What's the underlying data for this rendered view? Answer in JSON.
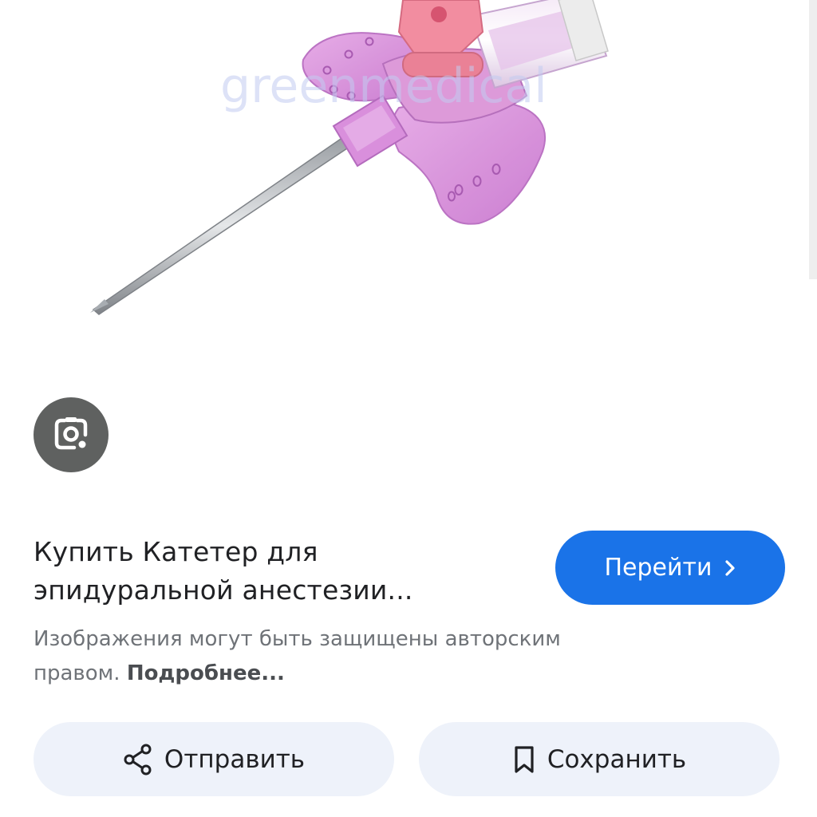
{
  "image": {
    "watermark": "greenmedical",
    "icon": "catheter-product-image"
  },
  "lens": {
    "icon": "lens-icon"
  },
  "result": {
    "title": "Купить Катетер для эпидуральной анестезии...",
    "goto_label": "Перейти",
    "goto_icon": "chevron-right-icon",
    "notice_text": "Изображения могут быть защищены авторским правом. ",
    "notice_more": "Подробнее..."
  },
  "actions": {
    "share_label": "Отправить",
    "share_icon": "share-icon",
    "save_label": "Сохранить",
    "save_icon": "bookmark-icon"
  },
  "colors": {
    "accent": "#1a73e8",
    "pill_bg": "#eef2fa",
    "lens_bg": "#5f6160",
    "catheter_pink": "#d98fdc"
  }
}
